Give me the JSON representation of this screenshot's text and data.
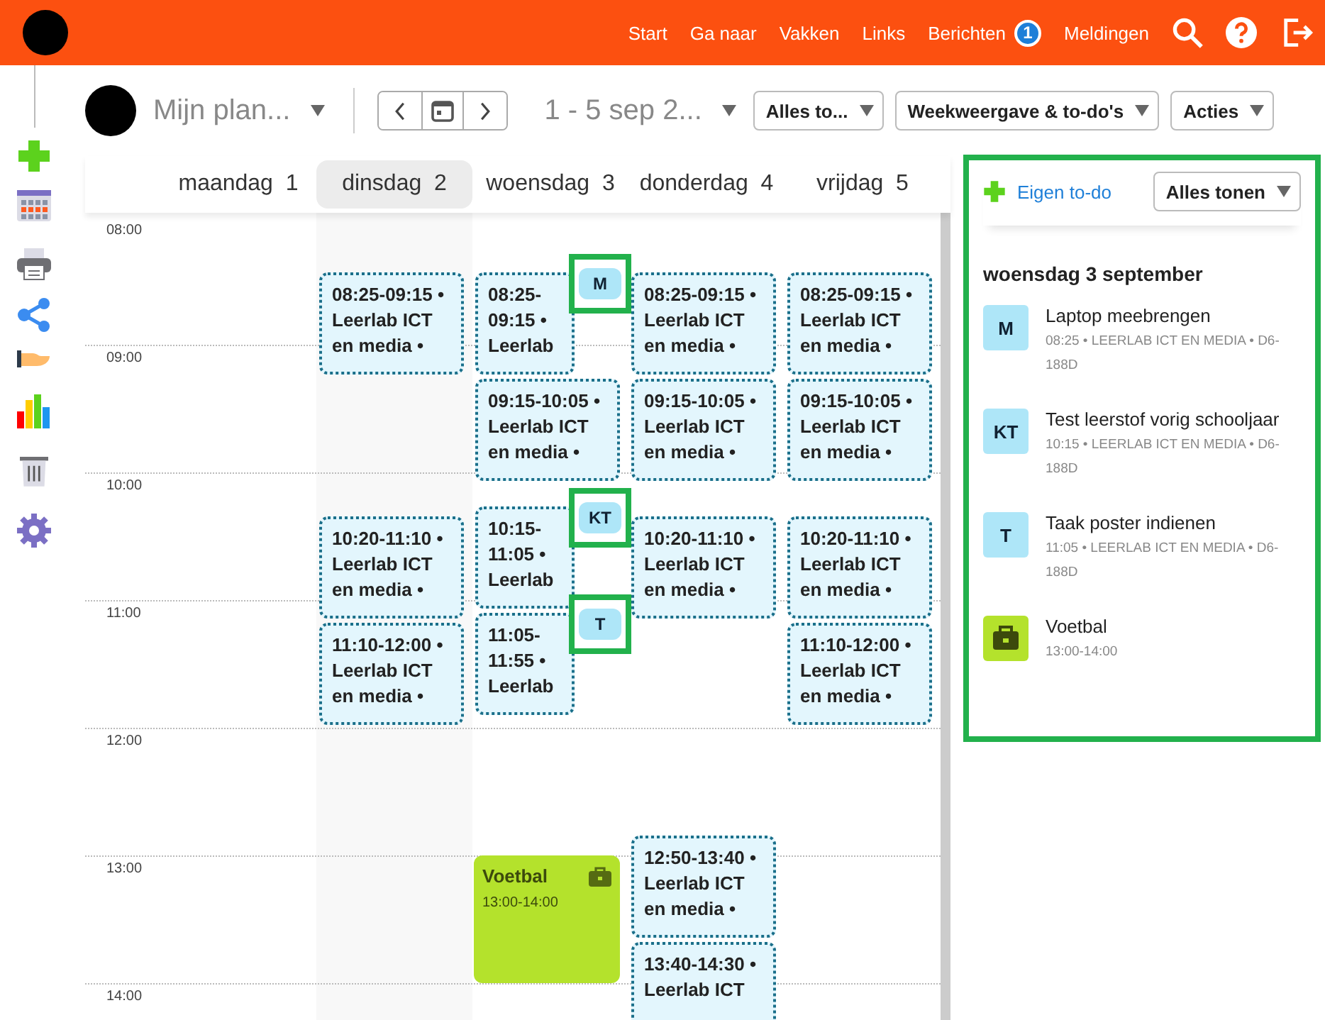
{
  "topbar": {
    "nav": [
      {
        "label": "Start"
      },
      {
        "label": "Ga naar"
      },
      {
        "label": "Vakken"
      },
      {
        "label": "Links"
      },
      {
        "label": "Berichten",
        "badge": "1"
      },
      {
        "label": "Meldingen"
      }
    ]
  },
  "toolbar": {
    "planner_title": "Mijn plan...",
    "date_range": "1 - 5 sep 2...",
    "dropdowns": [
      "Alles to...",
      "Weekweergave & to-do's",
      "Acties"
    ]
  },
  "hours": [
    "08:00",
    "09:00",
    "10:00",
    "11:00",
    "12:00",
    "13:00",
    "14:00"
  ],
  "days": [
    {
      "name": "maandag",
      "number": "1",
      "selected": false
    },
    {
      "name": "dinsdag",
      "number": "2",
      "selected": true,
      "events": [
        {
          "kind": "lesson",
          "time": "08:25-09:15",
          "details": "• Leerlab ICT en media •"
        },
        {
          "kind": "lesson",
          "time": "10:20-11:10",
          "details": "• Leerlab ICT en media •"
        },
        {
          "kind": "lesson",
          "time": "11:10-12:00",
          "details": "• Leerlab ICT en media •"
        }
      ]
    },
    {
      "name": "woensdag",
      "number": "3",
      "selected": false,
      "events": [
        {
          "kind": "lesson",
          "time": "08:25-09:15",
          "details": "• Leerlab",
          "todo": "M"
        },
        {
          "kind": "lesson",
          "time": "09:15-10:05",
          "details": "• Leerlab ICT en media •"
        },
        {
          "kind": "lesson",
          "time": "10:15-11:05",
          "details": "• Leerlab",
          "todo": "KT"
        },
        {
          "kind": "lesson",
          "time": "11:05-11:55",
          "details": "• Leerlab",
          "todo": "T"
        },
        {
          "kind": "activity",
          "time": "13:00-14:00",
          "details": "Voetbal"
        }
      ]
    },
    {
      "name": "donderdag",
      "number": "4",
      "selected": false,
      "events": [
        {
          "kind": "lesson",
          "time": "08:25-09:15",
          "details": "• Leerlab ICT en media •"
        },
        {
          "kind": "lesson",
          "time": "09:15-10:05",
          "details": "• Leerlab ICT en media •"
        },
        {
          "kind": "lesson",
          "time": "10:20-11:10",
          "details": "• Leerlab ICT en media •"
        },
        {
          "kind": "lesson",
          "time": "12:50-13:40",
          "details": "• Leerlab ICT en media •"
        },
        {
          "kind": "lesson",
          "time": "13:40-14:30",
          "details": "• Leerlab ICT"
        }
      ]
    },
    {
      "name": "vrijdag",
      "number": "5",
      "selected": false,
      "events": [
        {
          "kind": "lesson",
          "time": "08:25-09:15",
          "details": "• Leerlab ICT en media •"
        },
        {
          "kind": "lesson",
          "time": "09:15-10:05",
          "details": "• Leerlab ICT en media •"
        },
        {
          "kind": "lesson",
          "time": "10:20-11:10",
          "details": "• Leerlab ICT en media •"
        },
        {
          "kind": "lesson",
          "time": "11:10-12:00",
          "details": "• Leerlab ICT en media •"
        }
      ]
    }
  ],
  "todo_panel": {
    "add_label": "Eigen to-do",
    "filter": "Alles tonen",
    "date_heading": "woensdag 3 september",
    "items": [
      {
        "kind": "todo",
        "badge": "M",
        "title": "Laptop meebrengen",
        "meta": "08:25 • LEERLAB ICT EN MEDIA • D6-188D"
      },
      {
        "kind": "todo",
        "badge": "KT",
        "title": "Test leerstof vorig schooljaar",
        "meta": "10:15 • LEERLAB ICT EN MEDIA • D6-188D"
      },
      {
        "kind": "todo",
        "badge": "T",
        "title": "Taak poster indienen",
        "meta": "11:05 • LEERLAB ICT EN MEDIA • D6-188D"
      },
      {
        "kind": "activity",
        "title": "Voetbal",
        "meta": "13:00-14:00"
      }
    ]
  }
}
